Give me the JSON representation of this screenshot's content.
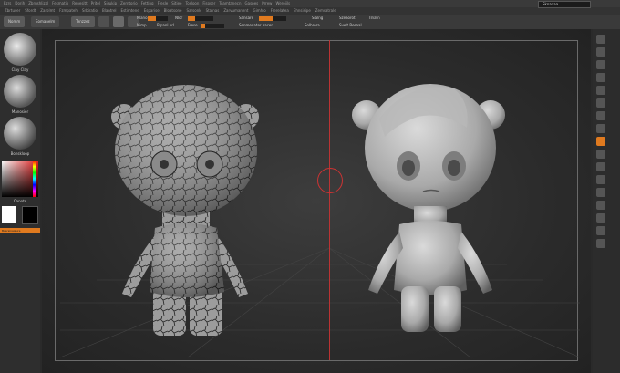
{
  "menu": [
    "Ezrs",
    "Dorih",
    "Zbrushlizal",
    "Fesmatio",
    "Repesitt",
    "Pritel",
    "Sisukip",
    "Zerntorio",
    "Fetting",
    "Fresle",
    "Sitiee",
    "Tosloon",
    "Fisoser",
    "Toamtanecn",
    "Gaspes",
    "Prrew",
    "Weroiils"
  ],
  "submenu": [
    "Zbrtuser",
    "Sfordt",
    "Zarolmt",
    "Fzmpateh",
    "Srbiratio",
    "Blantrel",
    "Estimtene",
    "Esparise",
    "Bloatsone",
    "Sarsonk",
    "Stalnas",
    "Zarvumanent",
    "Gimhio",
    "Frerelatea",
    "Ehnsisipe",
    "Zemsatrale"
  ],
  "search": {
    "text": "Sknaaaa"
  },
  "toolbar": {
    "btn1": "Nomm",
    "btn2": "Eomanelm",
    "btn3": "Tenzzez",
    "controls": [
      "Nlano",
      "Brnat",
      "Nlor",
      "Estr",
      "Hreo",
      "Sansare",
      "8",
      "Rrwtt",
      "Szeaorot",
      "Sialng",
      "Tlnatn"
    ],
    "controls2": [
      "Nimp",
      "Bipanl.orl",
      "Frese",
      "Ess",
      "Burper",
      "Pinit",
      "Senmenater eacer",
      "Nrp",
      "Solbrera",
      "Svelt Besaal",
      "Enrerrnaspy"
    ]
  },
  "left_panel": {
    "brush1": "Clay Clay",
    "brush2": "Manosier",
    "brush3": "Bonskloop",
    "color_label": "Canote",
    "footer": "Basrsinaiaure"
  },
  "colors": {
    "accent": "#e07a1f",
    "primary": "#ffffff",
    "secondary": "#000000"
  },
  "icons": [
    "lock-icon",
    "grid-icon",
    "camera-icon",
    "frame-icon",
    "move-icon",
    "scale-icon",
    "rotate-icon",
    "persp-icon",
    "floor-icon",
    "local-icon",
    "xyz-icon",
    "solo-icon",
    "transp-icon",
    "ghost-icon",
    "poly-icon",
    "dynamic-icon",
    "setting-icon"
  ]
}
